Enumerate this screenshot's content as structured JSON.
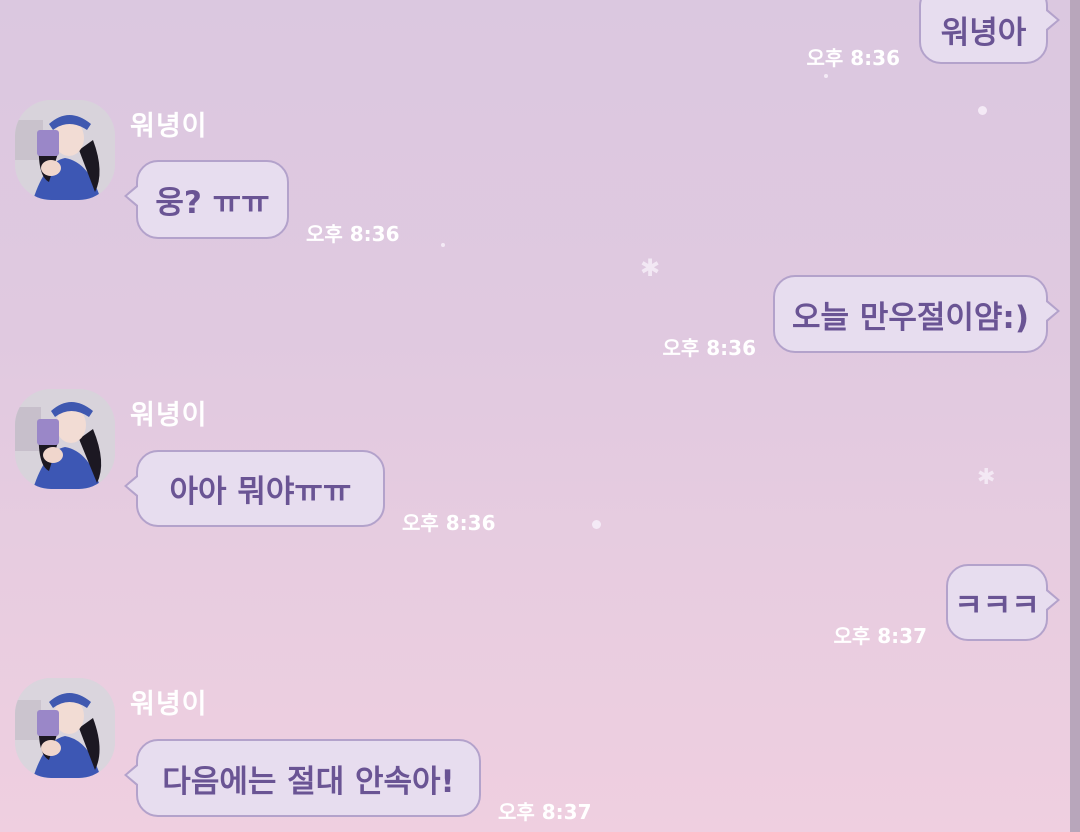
{
  "colors": {
    "bubble_fill": "#e7ddef",
    "bubble_border": "#b3a2cb",
    "bubble_text": "#6a5494",
    "meta_text": "#ffffff",
    "background_top": "#dbc8e0",
    "background_bottom": "#efcfe0"
  },
  "contact": {
    "name": "워녕이",
    "avatar_icon": "profile-photo-icon"
  },
  "messages": [
    {
      "side": "outgoing",
      "text": "워녕아",
      "time": "오후 8:36"
    },
    {
      "side": "incoming",
      "sender": "워녕이",
      "text": "웅? ㅠㅠ",
      "time": "오후 8:36"
    },
    {
      "side": "outgoing",
      "text": "오늘 만우절이얌:)",
      "time": "오후 8:36"
    },
    {
      "side": "incoming",
      "sender": "워녕이",
      "text": "아아 뭐야ㅠㅠ",
      "time": "오후 8:36"
    },
    {
      "side": "outgoing",
      "text": "ㅋㅋㅋ",
      "time": "오후 8:37"
    },
    {
      "side": "incoming",
      "sender": "워녕이",
      "text": "다음에는 절대 안속아!",
      "time": "오후 8:37"
    }
  ]
}
